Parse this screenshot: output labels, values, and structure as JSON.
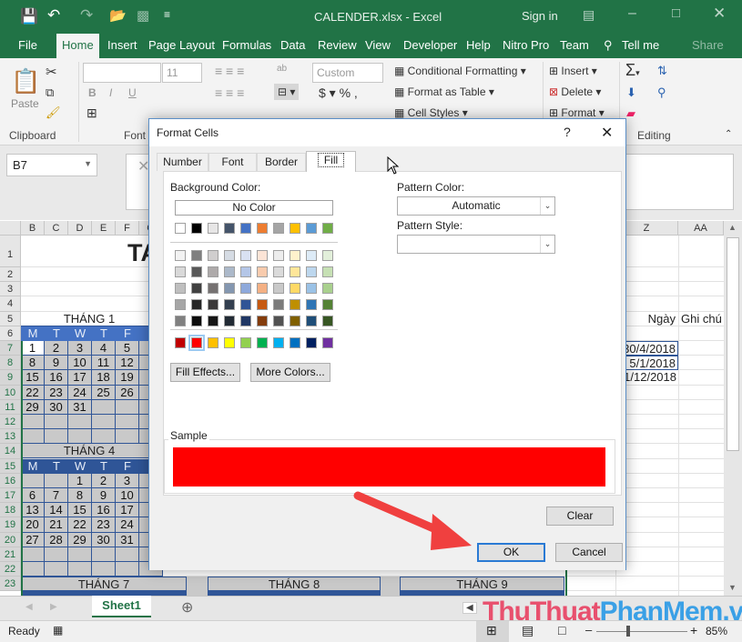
{
  "window": {
    "title": "CALENDER.xlsx  -  Excel",
    "sign_in": "Sign in"
  },
  "ribbon_tabs": [
    "File",
    "Home",
    "Insert",
    "Page Layout",
    "Formulas",
    "Data",
    "Review",
    "View",
    "Developer",
    "Help",
    "Nitro Pro",
    "Team",
    "Tell me",
    "Share"
  ],
  "ribbon": {
    "paste": "Paste",
    "font_size": "11",
    "number_format": "Custom",
    "conditional_formatting": "Conditional Formatting",
    "format_as_table": "Format as Table",
    "cell_styles": "Cell Styles",
    "insert": "Insert",
    "delete": "Delete",
    "format": "Format",
    "groups": {
      "clipboard": "Clipboard",
      "font": "Font",
      "editing": "Editing"
    }
  },
  "name_box": "B7",
  "columns_left": [
    "B",
    "C",
    "D",
    "E",
    "F",
    "G"
  ],
  "columns_right": [
    "Z",
    "AA"
  ],
  "rows": [
    "1",
    "2",
    "3",
    "4",
    "5",
    "6",
    "7",
    "8",
    "9",
    "10",
    "11",
    "12",
    "13",
    "14",
    "15",
    "16",
    "17",
    "18",
    "19",
    "20",
    "21",
    "22",
    "23"
  ],
  "sheet": {
    "title_fragment": "TA",
    "month1": {
      "label": "THÁNG 1",
      "days": [
        "M",
        "T",
        "W",
        "T",
        "F"
      ],
      "weeks": [
        [
          "1",
          "2",
          "3",
          "4",
          "5"
        ],
        [
          "8",
          "9",
          "10",
          "11",
          "12"
        ],
        [
          "15",
          "16",
          "17",
          "18",
          "19"
        ],
        [
          "22",
          "23",
          "24",
          "25",
          "26"
        ],
        [
          "29",
          "30",
          "31",
          "",
          ""
        ]
      ]
    },
    "month4": {
      "label": "THÁNG 4",
      "days": [
        "M",
        "T",
        "W",
        "T",
        "F"
      ],
      "weeks": [
        [
          "",
          "",
          "1",
          "2",
          "3"
        ],
        [
          "6",
          "7",
          "8",
          "9",
          "10"
        ],
        [
          "13",
          "14",
          "15",
          "16",
          "17"
        ],
        [
          "20",
          "21",
          "22",
          "23",
          "24"
        ],
        [
          "27",
          "28",
          "29",
          "30",
          "31"
        ]
      ]
    },
    "month7": "THÁNG 7",
    "month8": "THÁNG 8",
    "month9": "THÁNG 9",
    "right_header_date": "Ngày",
    "right_header_note": "Ghi chú",
    "dates": [
      "30/4/2018",
      "5/1/2018",
      "1/12/2018"
    ]
  },
  "sheet_tab": "Sheet1",
  "status": {
    "ready": "Ready",
    "zoom": "85%",
    "zoom_level_percent": 85
  },
  "dialog": {
    "title": "Format Cells",
    "help": "?",
    "tabs": [
      "Number",
      "Font",
      "Border",
      "Fill"
    ],
    "active_tab": "Fill",
    "background_color_label": "Background Color:",
    "no_color": "No Color",
    "theme_row": [
      "#FFFFFF",
      "#000000",
      "#E7E6E6",
      "#44546A",
      "#4472C4",
      "#ED7D31",
      "#A5A5A5",
      "#FFC000",
      "#5B9BD5",
      "#70AD47"
    ],
    "tint_rows": [
      [
        "#F2F2F2",
        "#7F7F7F",
        "#D0CECE",
        "#D6DCE4",
        "#D9E1F2",
        "#FCE4D6",
        "#EDEDED",
        "#FFF2CC",
        "#DDEBF7",
        "#E2EFDA"
      ],
      [
        "#D9D9D9",
        "#595959",
        "#AEAAAA",
        "#ACB9CA",
        "#B4C6E7",
        "#F8CBAD",
        "#DBDBDB",
        "#FFE699",
        "#BDD7EE",
        "#C6E0B4"
      ],
      [
        "#BFBFBF",
        "#404040",
        "#757171",
        "#8497B0",
        "#8EA9DB",
        "#F4B084",
        "#C9C9C9",
        "#FFD966",
        "#9BC2E6",
        "#A9D08E"
      ],
      [
        "#A6A6A6",
        "#262626",
        "#3A3838",
        "#333F4F",
        "#305496",
        "#C65911",
        "#7B7B7B",
        "#BF8F00",
        "#2F75B5",
        "#548235"
      ],
      [
        "#808080",
        "#0D0D0D",
        "#161616",
        "#222B35",
        "#203764",
        "#833C0C",
        "#525252",
        "#806000",
        "#1F4E78",
        "#375623"
      ]
    ],
    "standard_row": [
      "#C00000",
      "#FF0000",
      "#FFC000",
      "#FFFF00",
      "#92D050",
      "#00B050",
      "#00B0F0",
      "#0070C0",
      "#002060",
      "#7030A0"
    ],
    "selected_color": "#FF0000",
    "fill_effects": "Fill Effects...",
    "more_colors": "More Colors...",
    "pattern_color_label": "Pattern Color:",
    "pattern_color_value": "Automatic",
    "pattern_style_label": "Pattern Style:",
    "pattern_style_value": "",
    "sample_label": "Sample",
    "clear": "Clear",
    "ok": "OK",
    "cancel": "Cancel"
  },
  "watermark": "ThuThuatPhanMem.vn",
  "colors": {
    "excel_green": "#217346",
    "calendar_blue": "#4472C4",
    "sample": "#FF0000"
  }
}
